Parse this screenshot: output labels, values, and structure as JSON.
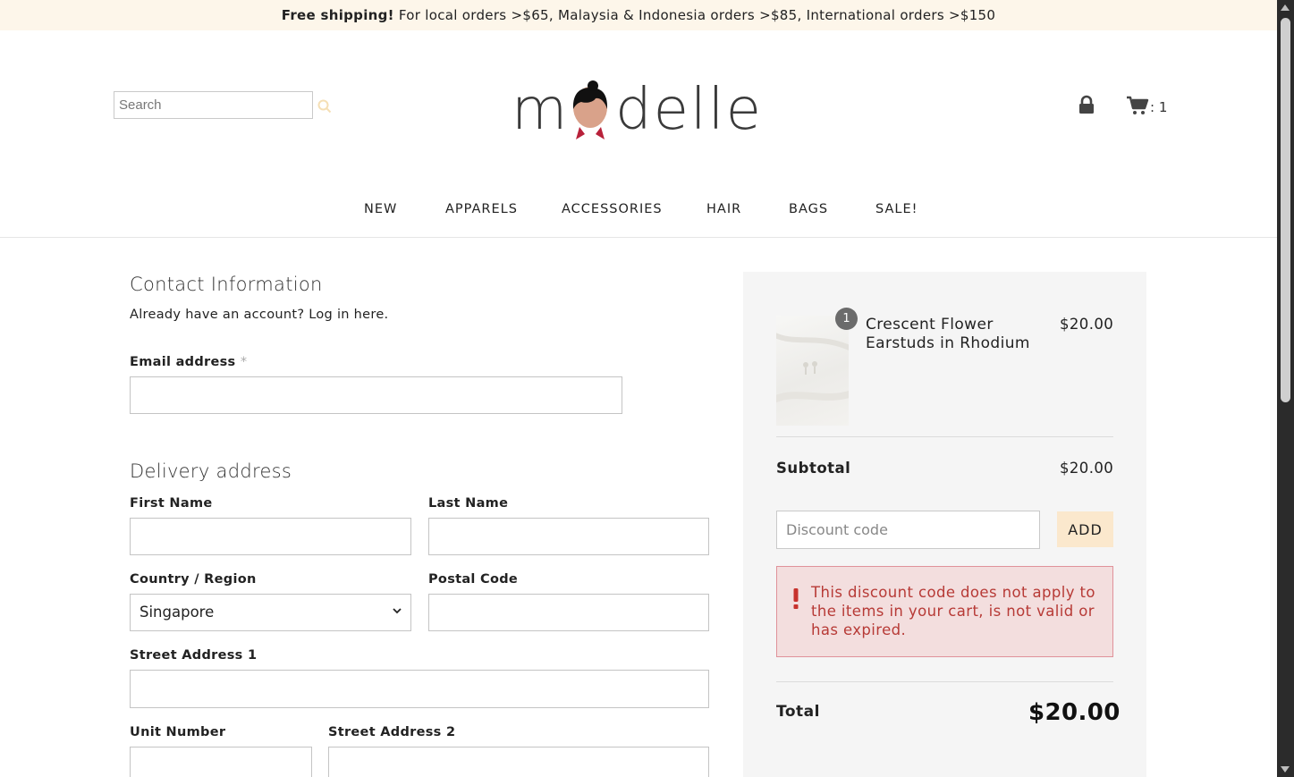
{
  "announcement": {
    "bold": "Free shipping!",
    "text": " For local orders >$65, Malaysia & Indonesia orders >$85, International orders >$150"
  },
  "header": {
    "search_placeholder": "Search",
    "logo_text_left": "m",
    "logo_text_right": "delle",
    "cart_count": ": 1"
  },
  "nav": {
    "items": [
      "NEW",
      "APPARELS",
      "ACCESSORIES",
      "HAIR",
      "BAGS",
      "SALE!"
    ]
  },
  "contact": {
    "heading": "Contact Information",
    "login_prompt": "Already have an account?",
    "login_link": "Log in here.",
    "email_label": "Email address",
    "required_mark": "*"
  },
  "delivery": {
    "heading": "Delivery address",
    "first_name": "First Name",
    "last_name": "Last Name",
    "country_label": "Country / Region",
    "country_value": "Singapore",
    "postal_label": "Postal Code",
    "street1_label": "Street Address 1",
    "unit_label": "Unit Number",
    "street2_label": "Street Address 2"
  },
  "summary": {
    "item": {
      "quantity": "1",
      "name": "Crescent Flower Earstuds in Rhodium",
      "price": "$20.00"
    },
    "subtotal_label": "Subtotal",
    "subtotal_value": "$20.00",
    "discount_placeholder": "Discount code",
    "add_label": "ADD",
    "error_text": "This discount code does not apply to the items in your cart, is not valid or has expired.",
    "total_label": "Total",
    "total_value": "$20.00"
  },
  "colors": {
    "accent": "#fbe8cd",
    "promo_bg": "#fdf6ea",
    "error_text": "#b73a36",
    "error_bg": "#f3dede",
    "error_border": "#e0929a"
  }
}
